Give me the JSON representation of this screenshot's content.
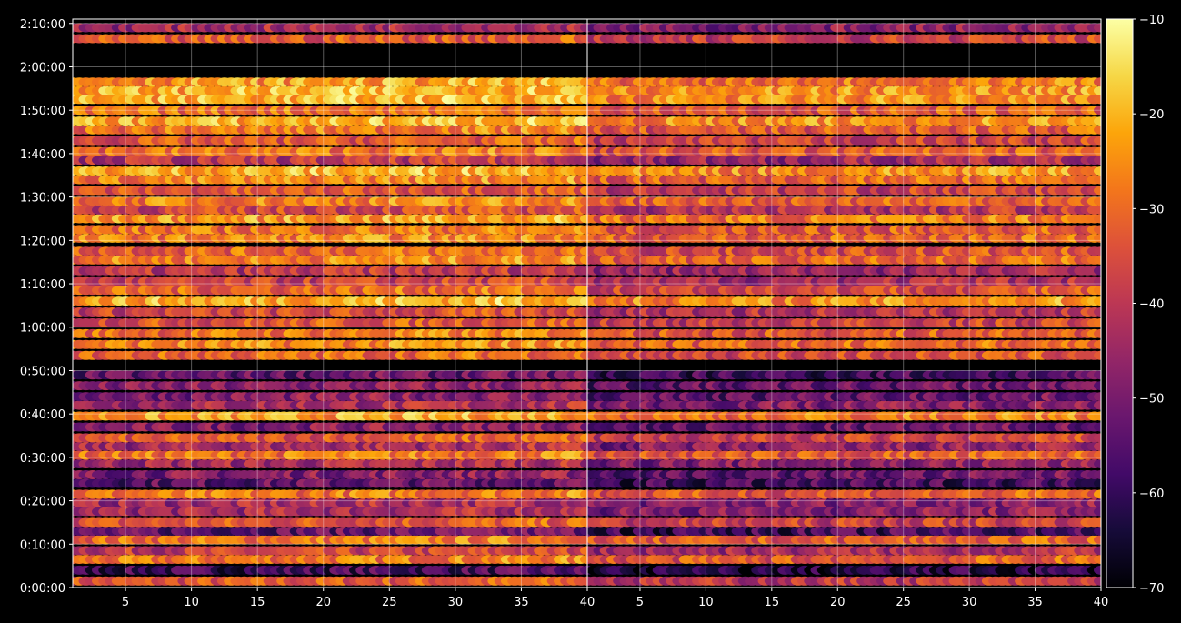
{
  "chart_data": {
    "type": "heatmap",
    "title": "",
    "panels": [
      {
        "name": "",
        "x_ticks": [
          "5",
          "10",
          "15",
          "20",
          "25",
          "30",
          "35",
          "40"
        ],
        "x_tick_values": [
          5,
          10,
          15,
          20,
          25,
          30,
          35,
          40
        ],
        "xlim": [
          1,
          40
        ]
      },
      {
        "name": "",
        "x_ticks": [
          "5",
          "10",
          "15",
          "20",
          "25",
          "30",
          "35",
          "40"
        ],
        "x_tick_values": [
          5,
          10,
          15,
          20,
          25,
          30,
          35,
          40
        ],
        "xlim": [
          1,
          40
        ]
      }
    ],
    "y_axis": {
      "ticks": [
        "0:00:00",
        "0:10:00",
        "0:20:00",
        "0:30:00",
        "0:40:00",
        "0:50:00",
        "1:00:00",
        "1:10:00",
        "1:20:00",
        "1:30:00",
        "1:40:00",
        "1:50:00",
        "2:00:00",
        "2:10:00"
      ],
      "tick_minutes": [
        0,
        10,
        20,
        30,
        40,
        50,
        60,
        70,
        80,
        90,
        100,
        110,
        120,
        130
      ],
      "ylim_minutes": [
        0,
        131
      ]
    },
    "colorbar": {
      "ticks": [
        "−10",
        "−20",
        "−30",
        "−40",
        "−50",
        "−60",
        "−70"
      ],
      "tick_values": [
        -10,
        -20,
        -30,
        -40,
        -50,
        -60,
        -70
      ],
      "range": [
        -70,
        -10
      ],
      "colormap": "inferno"
    },
    "rows_minutes": [
      1.5,
      4,
      6.5,
      8.5,
      11,
      13,
      15,
      17.5,
      19.5,
      21.5,
      24,
      26,
      28.5,
      30.5,
      32.5,
      34.5,
      37,
      39.5,
      42,
      44,
      46.5,
      49,
      53.5,
      56,
      58.5,
      61,
      63.5,
      66,
      68.5,
      70.5,
      73,
      75.5,
      77.5,
      80.5,
      82.5,
      85,
      87,
      89,
      91.5,
      94,
      96,
      98.5,
      100.5,
      103,
      105.5,
      107.5,
      110,
      112.5,
      114.5,
      116.5,
      126.5,
      129
    ],
    "left_row_levels": [
      -35,
      -60,
      -30,
      -40,
      -30,
      -55,
      -35,
      -45,
      -45,
      -30,
      -55,
      -50,
      -45,
      -30,
      -45,
      -35,
      -50,
      -25,
      -45,
      -50,
      -50,
      -55,
      -32,
      -28,
      -30,
      -35,
      -38,
      -22,
      -32,
      -40,
      -42,
      -28,
      -32,
      -28,
      -30,
      -25,
      -38,
      -28,
      -35,
      -28,
      -22,
      -42,
      -30,
      -35,
      -30,
      -22,
      -30,
      -22,
      -22,
      -25,
      -35,
      -45
    ],
    "right_row_levels": [
      -42,
      -65,
      -35,
      -45,
      -35,
      -60,
      -40,
      -50,
      -50,
      -35,
      -60,
      -55,
      -50,
      -35,
      -50,
      -40,
      -55,
      -30,
      -50,
      -55,
      -55,
      -60,
      -37,
      -33,
      -35,
      -40,
      -43,
      -27,
      -37,
      -45,
      -47,
      -33,
      -37,
      -33,
      -35,
      -30,
      -43,
      -33,
      -40,
      -33,
      -27,
      -47,
      -35,
      -40,
      -35,
      -27,
      -35,
      -27,
      -27,
      -30,
      -40,
      -50
    ]
  }
}
